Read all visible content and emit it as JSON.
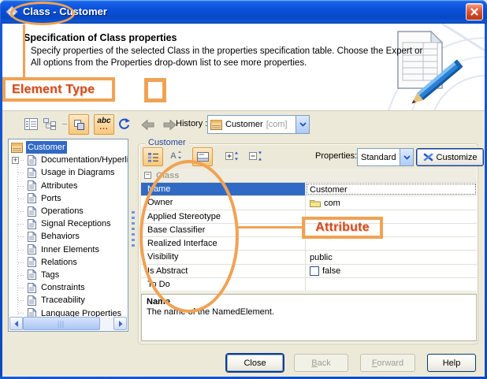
{
  "window": {
    "title": "Class - Customer"
  },
  "header": {
    "title": "Specification of Class properties",
    "line1": "Specify properties of the selected Class in the properties specification table. Choose the Expert or",
    "line2": "All options from the Properties drop-down list to see more properties."
  },
  "annotations": {
    "element_type": "Element Type",
    "attribute": "Attribute",
    "accent_color": "#f0a254",
    "text_color": "#cf4b28"
  },
  "toolbar": {
    "history_label": "History :",
    "history_name": "Customer",
    "history_qualifier": "[com]",
    "abc_label": "abc",
    "abc_dots": "...",
    "sort_letter": "A"
  },
  "tree": {
    "items": [
      {
        "label": "Customer",
        "icon": "class",
        "root": true,
        "selected": true
      },
      {
        "label": "Documentation/Hyperlinks",
        "icon": "doc",
        "expander": true
      },
      {
        "label": "Usage in Diagrams",
        "icon": "doc"
      },
      {
        "label": "Attributes",
        "icon": "doc"
      },
      {
        "label": "Ports",
        "icon": "doc"
      },
      {
        "label": "Operations",
        "icon": "doc"
      },
      {
        "label": "Signal Receptions",
        "icon": "doc"
      },
      {
        "label": "Behaviors",
        "icon": "doc"
      },
      {
        "label": "Inner Elements",
        "icon": "doc"
      },
      {
        "label": "Relations",
        "icon": "doc"
      },
      {
        "label": "Tags",
        "icon": "doc"
      },
      {
        "label": "Constraints",
        "icon": "doc"
      },
      {
        "label": "Traceability",
        "icon": "doc"
      },
      {
        "label": "Language Properties",
        "icon": "doc"
      }
    ]
  },
  "panel": {
    "group_title": "Customer",
    "properties_label": "Properties:",
    "properties_value": "Standard",
    "customize_label": "Customize",
    "category": "Class",
    "rows": [
      {
        "name": "Name",
        "value": "Customer",
        "type": "text",
        "selected": true
      },
      {
        "name": "Owner",
        "value": "com",
        "type": "folder"
      },
      {
        "name": "Applied Stereotype",
        "value": "",
        "type": "empty"
      },
      {
        "name": "Base Classifier",
        "value": "",
        "type": "empty"
      },
      {
        "name": "Realized Interface",
        "value": "",
        "type": "empty"
      },
      {
        "name": "Visibility",
        "value": "public",
        "type": "text"
      },
      {
        "name": "Is Abstract",
        "value": "false",
        "type": "checkbox"
      },
      {
        "name": "To Do",
        "value": "",
        "type": "empty"
      }
    ],
    "description_title": "Name",
    "description_text": "The name of the NamedElement."
  },
  "buttons": [
    {
      "label": "Close",
      "enabled": true,
      "default": true
    },
    {
      "label": "Back",
      "enabled": false,
      "underline": true
    },
    {
      "label": "Forward",
      "enabled": false,
      "underline": true
    },
    {
      "label": "Help",
      "enabled": true
    }
  ],
  "colors": {
    "selection": "#316ac5",
    "dialog_bg": "#ece9d8",
    "titlebar": "#0a50d8"
  }
}
